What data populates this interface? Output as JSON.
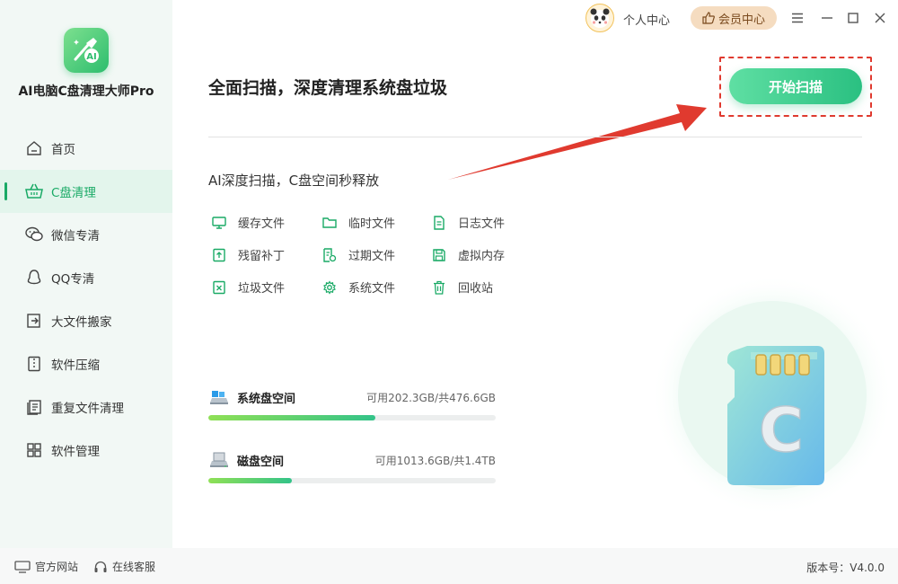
{
  "app": {
    "name": "AI电脑C盘清理大师Pro"
  },
  "sidebar": {
    "items": [
      {
        "label": "首页",
        "icon": "home-icon",
        "active": false
      },
      {
        "label": "C盘清理",
        "icon": "basket-icon",
        "active": true
      },
      {
        "label": "微信专清",
        "icon": "wechat-icon",
        "active": false
      },
      {
        "label": "QQ专清",
        "icon": "qq-icon",
        "active": false
      },
      {
        "label": "大文件搬家",
        "icon": "move-file-icon",
        "active": false
      },
      {
        "label": "软件压缩",
        "icon": "zip-icon",
        "active": false
      },
      {
        "label": "重复文件清理",
        "icon": "duplicate-file-icon",
        "active": false
      },
      {
        "label": "软件管理",
        "icon": "apps-grid-icon",
        "active": false
      }
    ]
  },
  "topbar": {
    "user_center": "个人中心",
    "vip_center": "会员中心"
  },
  "main": {
    "title": "全面扫描，深度清理系统盘垃圾",
    "scan_button": "开始扫描",
    "subtitle": "AI深度扫描，C盘空间秒释放",
    "file_types": [
      {
        "label": "缓存文件",
        "icon": "monitor-icon"
      },
      {
        "label": "临时文件",
        "icon": "folder-icon"
      },
      {
        "label": "日志文件",
        "icon": "log-file-icon"
      },
      {
        "label": "残留补丁",
        "icon": "patch-upload-icon"
      },
      {
        "label": "过期文件",
        "icon": "expired-file-icon"
      },
      {
        "label": "虚拟内存",
        "icon": "memory-save-icon"
      },
      {
        "label": "垃圾文件",
        "icon": "junk-file-icon"
      },
      {
        "label": "系统文件",
        "icon": "system-gear-icon"
      },
      {
        "label": "回收站",
        "icon": "trash-icon"
      }
    ],
    "disks": [
      {
        "name": "系统盘空间",
        "info": "可用202.3GB/共476.6GB",
        "used_fraction": 0.58
      },
      {
        "name": "磁盘空间",
        "info": "可用1013.6GB/共1.4TB",
        "used_fraction": 0.29
      }
    ],
    "illustration_letter": "C"
  },
  "footer": {
    "website": "官方网站",
    "support": "在线客服",
    "version": "版本号：V4.0.0"
  },
  "colors": {
    "accent": "#1aaa66",
    "scan_button": "#2ac081",
    "annotation_red": "#e03a2f",
    "vip": "#f5dcc0"
  }
}
